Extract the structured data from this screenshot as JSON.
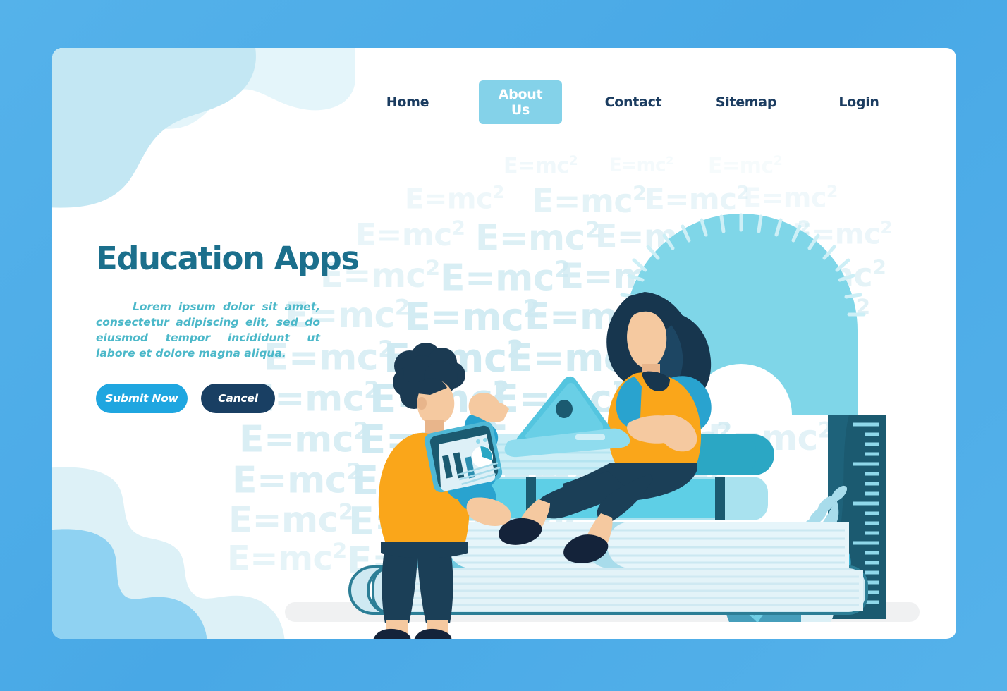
{
  "page": {
    "background_color": "#4EAEE8",
    "card_color": "#FFFFFF"
  },
  "nav": {
    "items": [
      {
        "label": "Home",
        "active": false
      },
      {
        "label": "About Us",
        "active": true
      },
      {
        "label": "Contact",
        "active": false
      },
      {
        "label": "Sitemap",
        "active": false
      },
      {
        "label": "Login",
        "active": false
      }
    ],
    "active_bg": "#84D2E9",
    "text_color": "#1B3C60"
  },
  "hero": {
    "title": "Education Apps",
    "description": "Lorem ipsum dolor sit amet, consectetur adipiscing elit, sed do eiusmod tempor incididunt ut labore et dolore magna aliqua.",
    "title_color": "#1B6F8C",
    "description_color": "#4BB8C9",
    "buttons": {
      "primary": {
        "label": "Submit Now",
        "color": "#1FA6E0"
      },
      "secondary": {
        "label": "Cancel",
        "color": "#193F63"
      }
    }
  },
  "watermark": {
    "formula_prefix": "E=mc",
    "formula_exponent": "2",
    "color": "#CFEAF2"
  },
  "illustration": {
    "scene_name": "students-studying-on-book-stack",
    "characters": [
      {
        "name": "standing-student-with-tablet",
        "hair_color": "#1B3A52",
        "shirt_color": "#FAA61A",
        "sleeve_color": "#29A3CF",
        "pants_color": "#1B3F57",
        "skin_color": "#F5C9A0",
        "shoe_color": "#14233A",
        "device": "tablet-dashboard"
      },
      {
        "name": "seated-student-with-laptop",
        "hair_color": "#17364E",
        "top_color": "#FAA61A",
        "sleeve_color": "#29A3CF",
        "pants_color": "#1B3F57",
        "skin_color": "#F5C9A0",
        "shoe_color": "#14233A",
        "device": "laptop"
      }
    ],
    "books": [
      {
        "name": "book-top",
        "cover": "#2BA7C4",
        "pages": "#B9E7F2"
      },
      {
        "name": "book-second",
        "cover": "#5ECFE6",
        "pages": "#A9E2EF"
      },
      {
        "name": "book-third",
        "cover": "#6FC9DF",
        "pages": "#D3EDF5"
      },
      {
        "name": "book-bottom",
        "cover": "#CFE9F2",
        "pages": "#E3F3F8"
      }
    ],
    "props": [
      {
        "name": "protractor",
        "color": "#7FD6E8"
      },
      {
        "name": "ruler",
        "color": "#1B5A70",
        "tick_color": "#8FD8EA"
      },
      {
        "name": "plant-leaf",
        "color": "#2BA7C4"
      },
      {
        "name": "ground-shadow",
        "color": "#F0F1F2"
      }
    ]
  }
}
